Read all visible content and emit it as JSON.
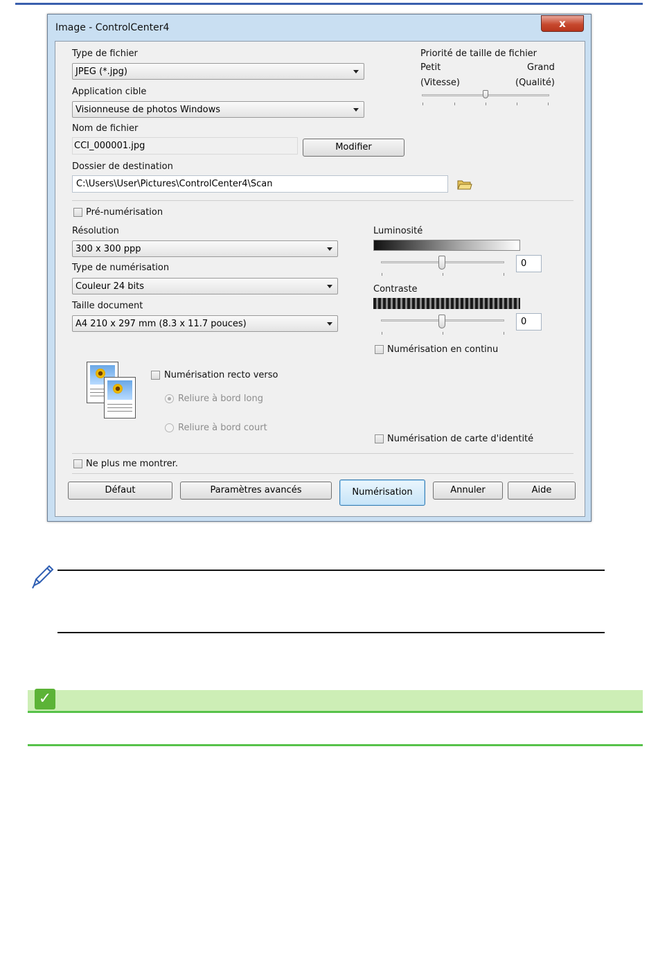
{
  "dialog": {
    "title": "Image - ControlCenter4",
    "close_glyph": "x",
    "file_type": {
      "label": "Type de fichier",
      "value": "JPEG (*.jpg)"
    },
    "target_app": {
      "label": "Application cible",
      "value": "Visionneuse de photos Windows"
    },
    "file_name": {
      "label": "Nom de fichier",
      "value": "CCI_000001.jpg",
      "modify_button": "Modifier"
    },
    "destination": {
      "label": "Dossier de destination",
      "value": "C:\\Users\\User\\Pictures\\ControlCenter4\\Scan"
    },
    "size_priority": {
      "label": "Priorité de taille de fichier",
      "small": "Petit",
      "large": "Grand",
      "speed": "(Vitesse)",
      "quality": "(Qualité)",
      "level": 0.5
    },
    "prescan": {
      "label": "Pré-numérisation",
      "checked": false
    },
    "resolution": {
      "label": "Résolution",
      "value": "300 x 300 ppp"
    },
    "scan_type": {
      "label": "Type de numérisation",
      "value": "Couleur 24 bits"
    },
    "document_size": {
      "label": "Taille document",
      "value": "A4 210 x 297 mm (8.3 x 11.7 pouces)"
    },
    "brightness": {
      "label": "Luminosité",
      "value": "0"
    },
    "contrast": {
      "label": "Contraste",
      "value": "0"
    },
    "continuous_scan": {
      "label": "Numérisation en continu",
      "checked": false
    },
    "duplex": {
      "label": "Numérisation recto verso",
      "checked": false,
      "long_edge": "Reliure à bord long",
      "short_edge": "Reliure à bord court"
    },
    "id_card": {
      "label": "Numérisation de carte d'identité",
      "checked": false
    },
    "dont_show": {
      "label": "Ne plus me montrer.",
      "checked": false
    },
    "buttons": {
      "default": "Défaut",
      "advanced": "Paramètres avancés",
      "scan": "Numérisation",
      "cancel": "Annuler",
      "help": "Aide"
    }
  },
  "colors": {
    "accent_blue": "#3a5fad",
    "green": "#57c24a",
    "green_bg": "#cdeeb6"
  },
  "icons": {
    "note": "pencil-icon",
    "folder": "folder-icon",
    "check": "checkmark-icon"
  }
}
